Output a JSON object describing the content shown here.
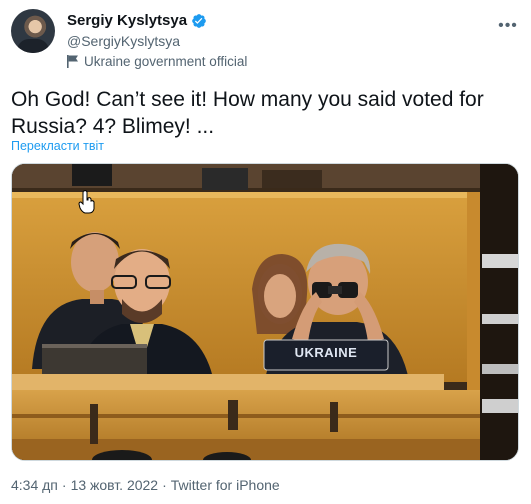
{
  "author": {
    "name": "Sergiy Kyslytsya",
    "handle": "@SergiyKyslytsya",
    "label": "Ukraine government official",
    "verified": true
  },
  "tweet": {
    "text": "Oh God! Can’t see it! How many you said voted for Russia? 4? Blimey! ...",
    "translate_label": "Перекласти твіт",
    "photo_placard": "UKRAINE"
  },
  "meta": {
    "time": "4:34 дп",
    "sep1": "·",
    "date": "13 жовт. 2022",
    "sep2": "·",
    "source": "Twitter for iPhone"
  },
  "icons": {
    "verified": "verified-badge-icon",
    "label": "flag-icon",
    "more": "more-horizontal-icon",
    "cursor": "hand-pointer-icon"
  },
  "colors": {
    "link": "#1d9bf0",
    "secondary": "#536471",
    "verified": "#1d9bf0"
  }
}
